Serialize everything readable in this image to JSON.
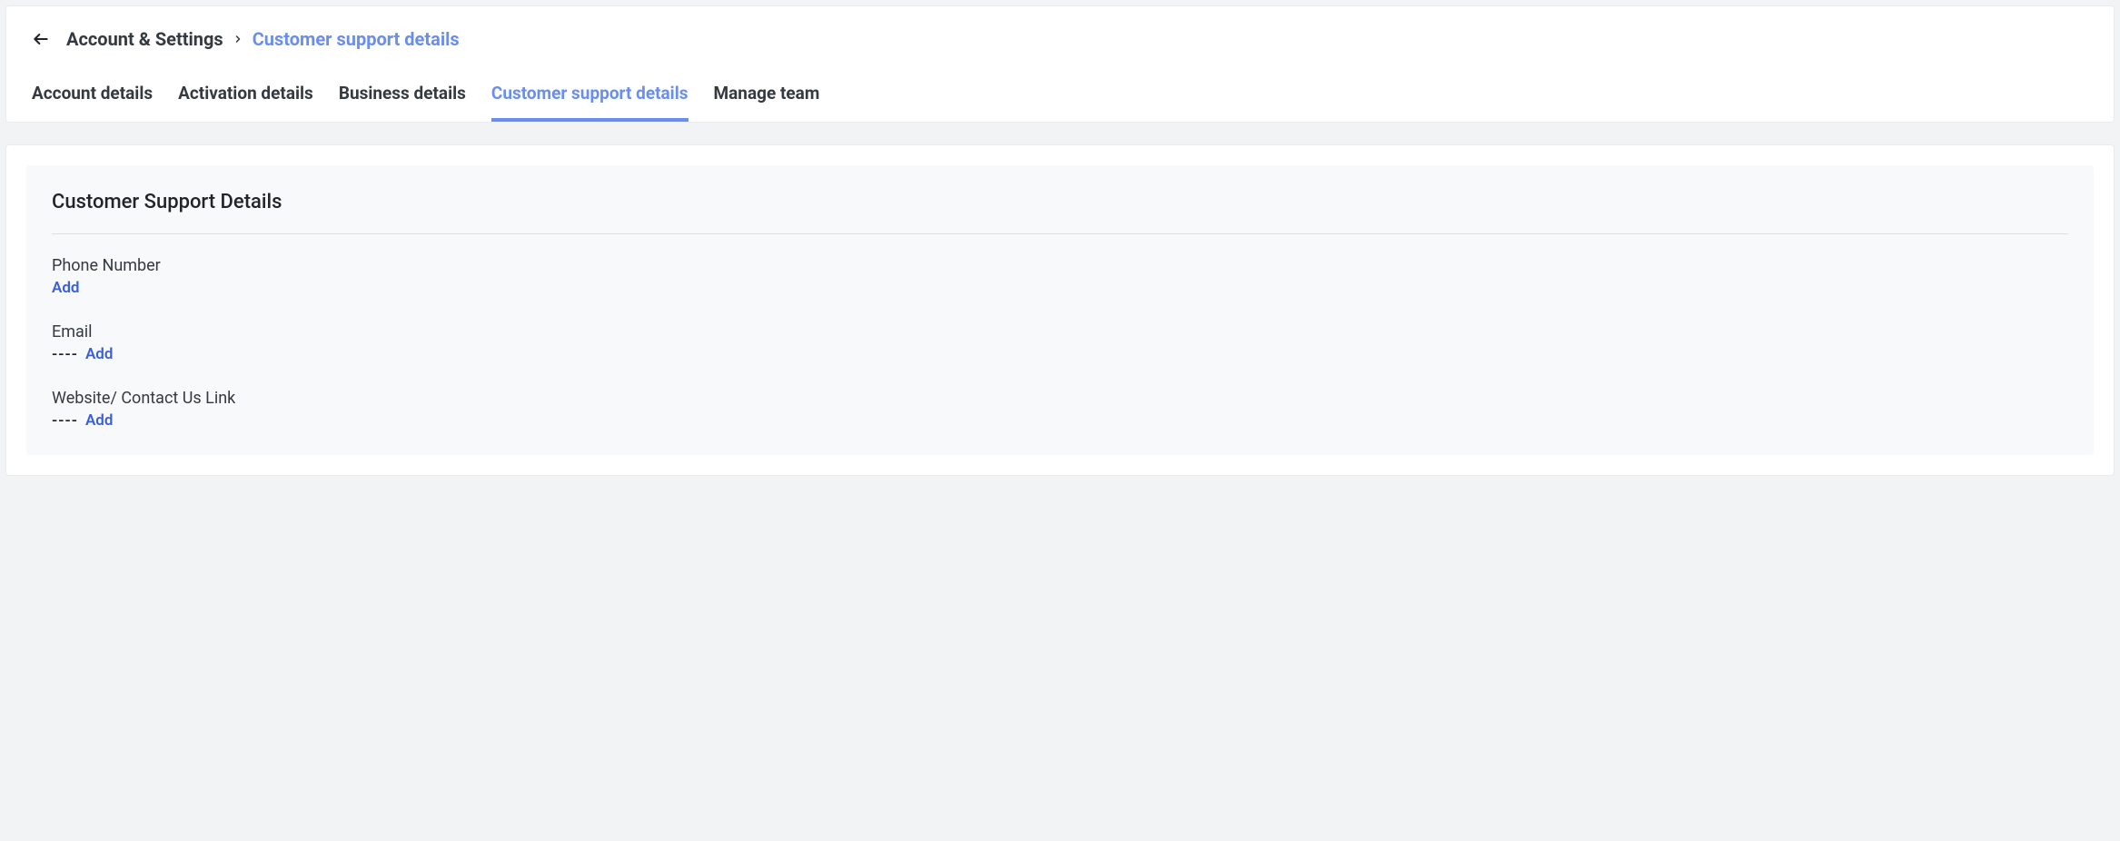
{
  "breadcrumb": {
    "parent": "Account & Settings",
    "current": "Customer support details"
  },
  "tabs": {
    "t0": "Account details",
    "t1": "Activation details",
    "t2": "Business details",
    "t3": "Customer support details",
    "t4": "Manage team"
  },
  "panel": {
    "title": "Customer Support Details",
    "fields": {
      "phone": {
        "label": "Phone Number",
        "placeholder": "",
        "action": "Add"
      },
      "email": {
        "label": "Email",
        "placeholder": "----",
        "action": "Add"
      },
      "website": {
        "label": "Website/ Contact Us Link",
        "placeholder": "----",
        "action": "Add"
      }
    }
  }
}
